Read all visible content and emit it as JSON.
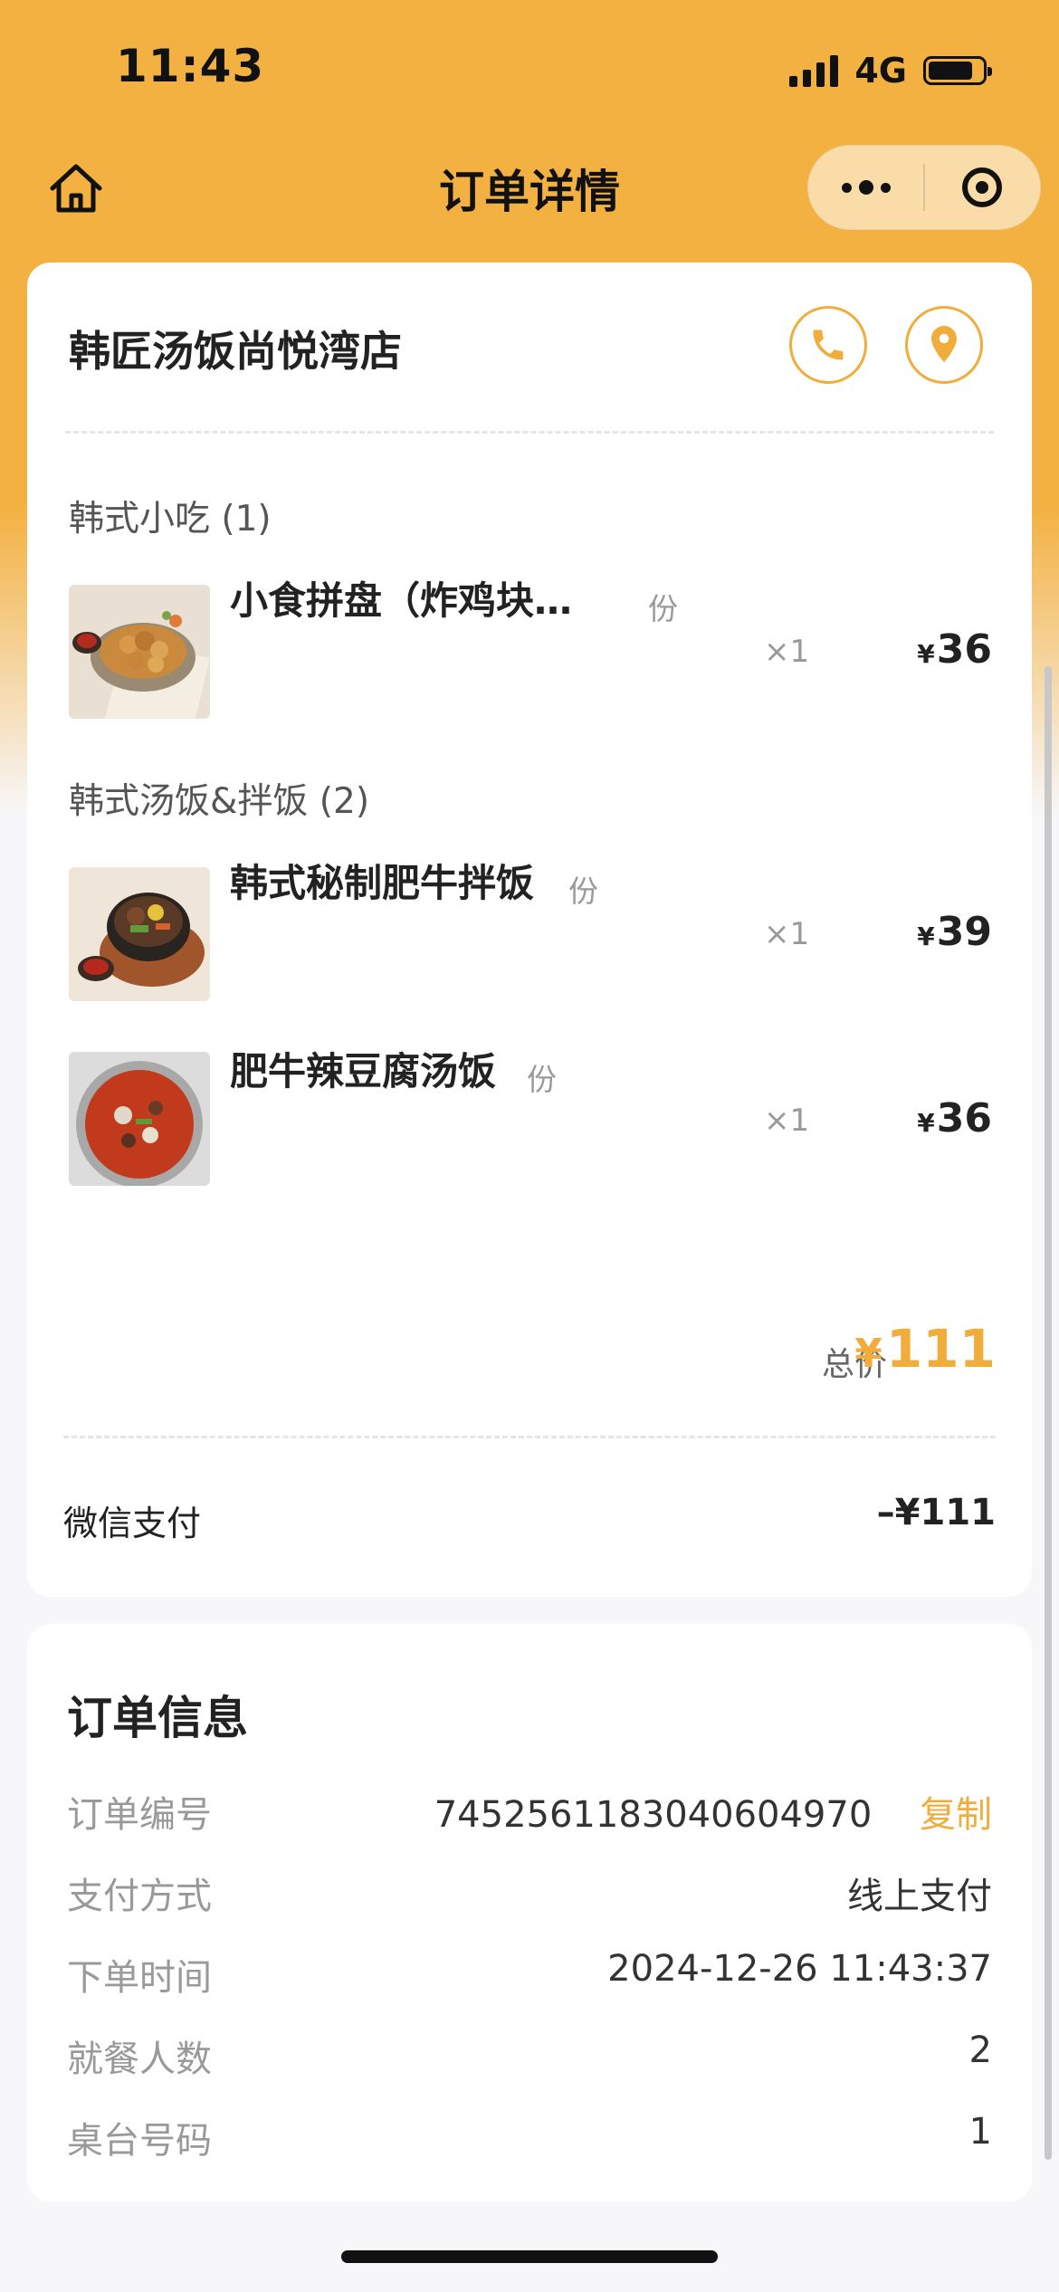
{
  "status_bar": {
    "time": "11:43",
    "network": "4G"
  },
  "nav": {
    "title": "订单详情"
  },
  "store": {
    "name": "韩匠汤饭尚悦湾店"
  },
  "categories": [
    {
      "label": "韩式小吃 (1)"
    },
    {
      "label": "韩式汤饭&拌饭 (2)"
    }
  ],
  "items": [
    {
      "name": "小食拼盘（炸鸡块…",
      "unit": "份",
      "qty": "×1",
      "currency": "¥",
      "price": "36"
    },
    {
      "name": "韩式秘制肥牛拌饭",
      "unit": "份",
      "qty": "×1",
      "currency": "¥",
      "price": "39"
    },
    {
      "name": "肥牛辣豆腐汤饭",
      "unit": "份",
      "qty": "×1",
      "currency": "¥",
      "price": "36"
    }
  ],
  "summary": {
    "total_label": "总价",
    "total_currency": "¥",
    "total_value": "111",
    "payment_method_label": "微信支付",
    "payment_amount": "–¥111"
  },
  "order_info": {
    "title": "订单信息",
    "rows": [
      {
        "key": "订单编号",
        "value": "7452561183040604970",
        "action": "复制"
      },
      {
        "key": "支付方式",
        "value": "线上支付"
      },
      {
        "key": "下单时间",
        "value": "2024-12-26 11:43:37"
      },
      {
        "key": "就餐人数",
        "value": "2"
      },
      {
        "key": "桌台号码",
        "value": "1"
      }
    ]
  },
  "colors": {
    "accent": "#f0ad3c",
    "header": "#f3b142",
    "background": "#f7f7f9"
  },
  "icons": [
    "home-icon",
    "more-dots-icon",
    "close-target-icon",
    "phone-icon",
    "location-pin-icon"
  ]
}
